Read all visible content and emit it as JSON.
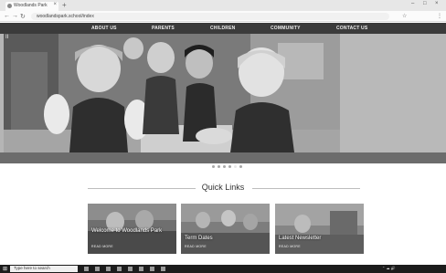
{
  "browser": {
    "tab_title": "Woodlands Park",
    "new_tab": "+",
    "tab_close": "×",
    "back": "←",
    "forward": "→",
    "reload": "↻",
    "url": "woodlandspark.school/index",
    "window_controls": [
      "–",
      "□",
      "×"
    ],
    "toolbar_icons": [
      "☆",
      "⋮"
    ]
  },
  "nav": {
    "items": [
      "ABOUT US",
      "PARENTS",
      "CHILDREN",
      "COMMUNITY",
      "CONTACT US"
    ]
  },
  "hero": {
    "pause": "II",
    "slide_count": 6,
    "active_slide": 5
  },
  "quick_links": {
    "heading": "Quick Links",
    "cards": [
      {
        "title": "Welcome to Woodlands Park",
        "more": "READ MORE"
      },
      {
        "title": "Term Dates",
        "more": "READ MORE"
      },
      {
        "title": "Latest Newsletter",
        "more": "READ MORE"
      }
    ]
  },
  "taskbar": {
    "start": "⊞",
    "search_placeholder": "Type here to search",
    "tray": "⌃ ☁ 🔊",
    "time": "",
    "date": ""
  }
}
